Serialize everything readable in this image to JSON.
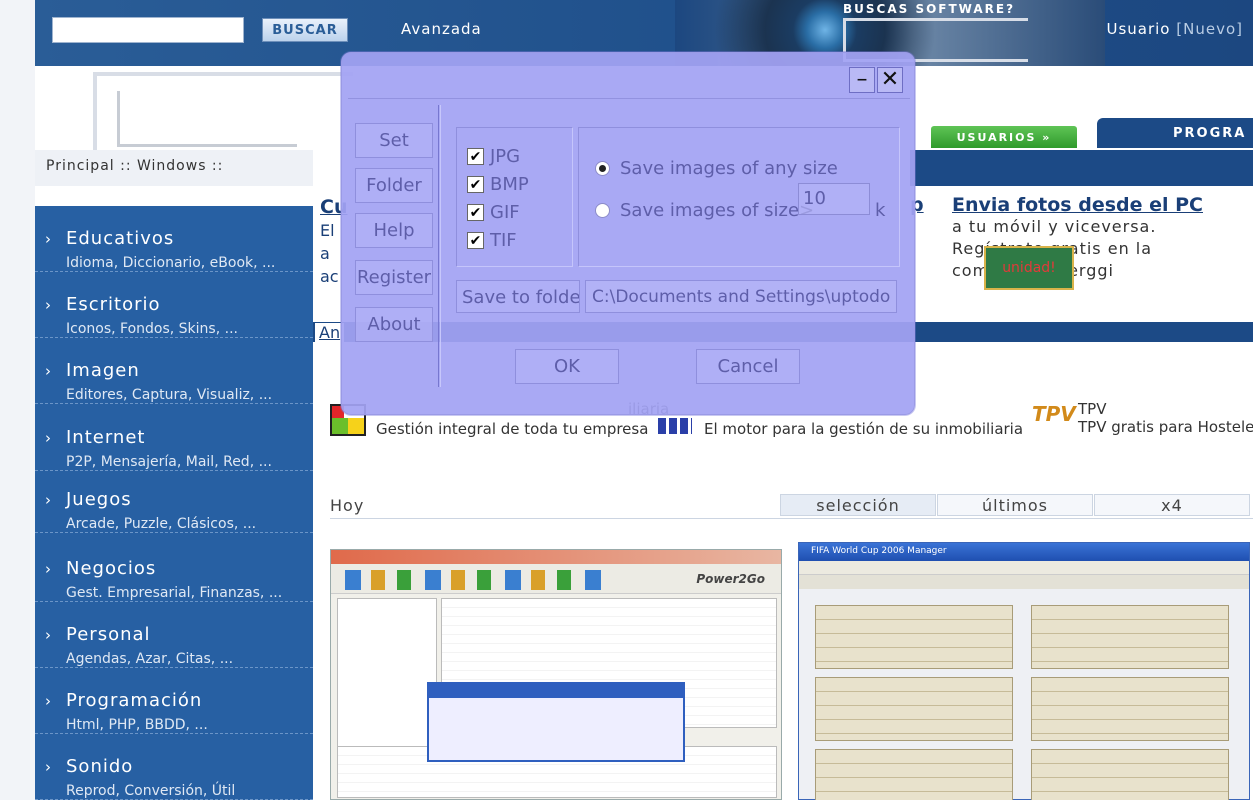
{
  "header": {
    "search_button": "BUSCAR",
    "advanced_link": "Avanzada",
    "brand_text": "BUSCAS SOFTWARE?",
    "user_label": "Usuario",
    "user_new": "[Nuevo]"
  },
  "tabs": {
    "usuarios": "USUARIOS »",
    "programas": "PROGRA"
  },
  "breadcrumb": "Principal :: Windows ::",
  "sidebar": {
    "categories": [
      {
        "title": "Educativos",
        "sub": "Idioma, Diccionario, eBook, ..."
      },
      {
        "title": "Escritorio",
        "sub": "Iconos, Fondos, Skins, ..."
      },
      {
        "title": "Imagen",
        "sub": "Editores, Captura, Visualiz, ..."
      },
      {
        "title": "Internet",
        "sub": "P2P, Mensajería, Mail, Red, ..."
      },
      {
        "title": "Juegos",
        "sub": "Arcade, Puzzle, Clásicos, ..."
      },
      {
        "title": "Negocios",
        "sub": "Gest. Empresarial, Finanzas, ..."
      },
      {
        "title": "Personal",
        "sub": "Agendas, Azar, Citas, ..."
      },
      {
        "title": "Programación",
        "sub": "Html, PHP, BBDD, ..."
      },
      {
        "title": "Sonido",
        "sub": "Reprod, Conversión, Útil"
      }
    ]
  },
  "promo": {
    "left_lines": [
      "Cu",
      "El",
      "a",
      "ac"
    ],
    "left_suffix": "p",
    "right_title": "Envia fotos desde el PC",
    "right_lines": [
      "a tu móvil y viceversa.",
      "Regístrate gratis en la",
      "comunidad Berggi"
    ],
    "sticker": "unidad!"
  },
  "an_link": "An",
  "ads": [
    {
      "title": "",
      "text": "Gestión integral de toda tu empresa"
    },
    {
      "title": "iliaria",
      "text": "El motor para la gestión de su inmobiliaria"
    },
    {
      "title": "TPV",
      "text": "TPV gratis para Hostelería"
    }
  ],
  "content_tabs": {
    "hoy": "Hoy",
    "items": [
      "selección",
      "últimos",
      "x4"
    ]
  },
  "thumbs": {
    "power2go_brand": "Power2Go",
    "fifa_title": "FIFA World Cup 2006 Manager"
  },
  "dialog": {
    "side_buttons": [
      "Set",
      "Folder",
      "Help",
      "Register",
      "About"
    ],
    "formats": [
      {
        "label": "JPG",
        "checked": true
      },
      {
        "label": "BMP",
        "checked": true
      },
      {
        "label": "GIF",
        "checked": true
      },
      {
        "label": "TIF",
        "checked": true
      }
    ],
    "radio_any": "Save images of any size",
    "radio_size": "Save images of size>",
    "size_value": "10",
    "size_unit": "k",
    "save_to_folder": "Save to folder",
    "folder_path": "C:\\Documents and Settings\\uptodo",
    "ok": "OK",
    "cancel": "Cancel",
    "minimize_glyph": "–",
    "close_glyph": "✕"
  }
}
